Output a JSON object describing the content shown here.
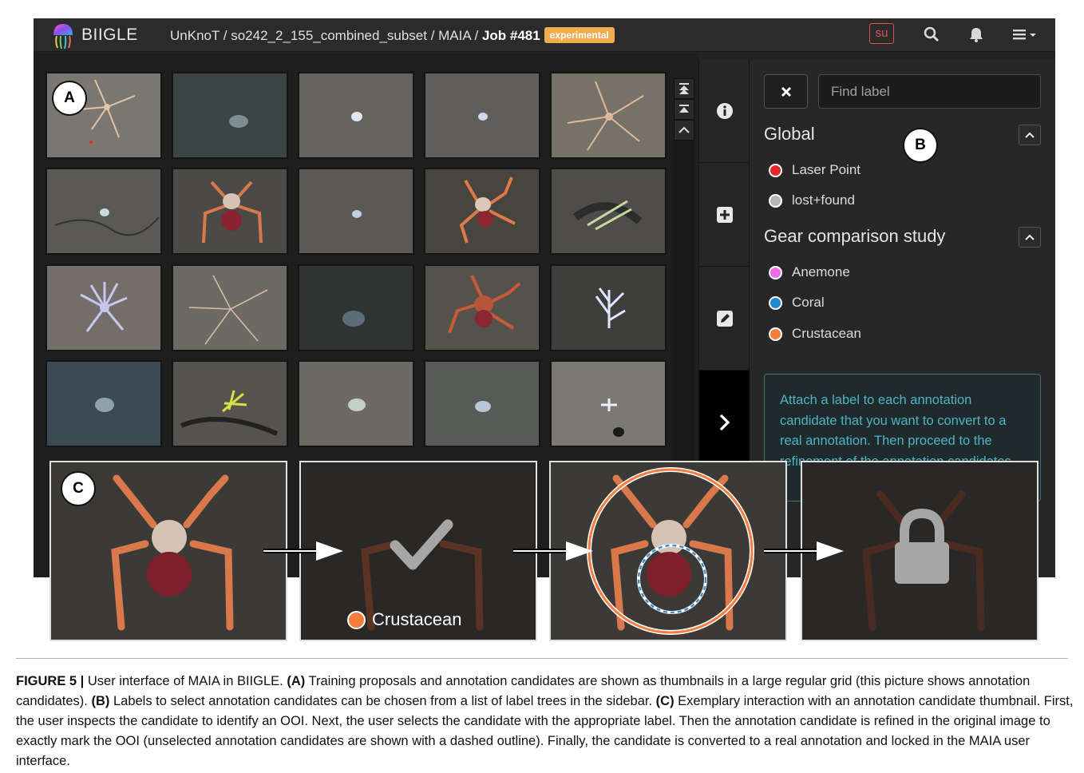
{
  "navbar": {
    "brand": "BIIGLE",
    "breadcrumb_path": "UnKnoT / so242_2_155_combined_subset / MAIA / ",
    "job": "Job #481",
    "badge": "experimental",
    "user_badge": "su",
    "icons": [
      "search-icon",
      "bell-icon",
      "menu-icon"
    ]
  },
  "markers": {
    "a": "A",
    "b": "B",
    "c": "C"
  },
  "sidebar": {
    "search_placeholder": "Find label",
    "trees": [
      {
        "title": "Global",
        "labels": [
          {
            "name": "Laser Point",
            "color": "#e8262a"
          },
          {
            "name": "lost+found",
            "color": "#b5b5b5"
          }
        ]
      },
      {
        "title": "Gear comparison study",
        "labels": [
          {
            "name": "Anemone",
            "color": "#ef6ce5"
          },
          {
            "name": "Coral",
            "color": "#1e88d2"
          },
          {
            "name": "Crustacean",
            "color": "#f47c3c"
          }
        ]
      }
    ],
    "help_text": "Attach a label to each annotation candidate that you want to convert to a real annotation. Then proceed to the refinement of the annotation candidates."
  },
  "panels": {
    "selected_label": "Crustacean"
  },
  "caption": {
    "title": "FIGURE 5 |",
    "intro": " User interface of MAIA in BIIGLE. ",
    "a_label": "(A)",
    "a_text": " Training proposals and annotation candidates are shown as thumbnails in a large regular grid (this picture shows annotation candidates). ",
    "b_label": "(B)",
    "b_text": " Labels to select annotation candidates can be chosen from a list of label trees in the sidebar. ",
    "c_label": "(C)",
    "c_text": " Exemplary interaction with an annotation candidate thumbnail. First, the user inspects the candidate to identify an OOI. Next, the user selects the candidate with the appropriate label. Then the annotation candidate is refined in the original image to exactly mark the OOI (unselected annotation candidates are shown with a dashed outline). Finally, the candidate is converted to a real annotation and locked in the MAIA user interface."
  },
  "colors": {
    "accent_badge": "#f0ad4e",
    "user_badge": "#d9534f",
    "help_text": "#4fb3c7",
    "selected_outline": "#f47c3c",
    "unselected_outline": "#3b8fd0"
  }
}
